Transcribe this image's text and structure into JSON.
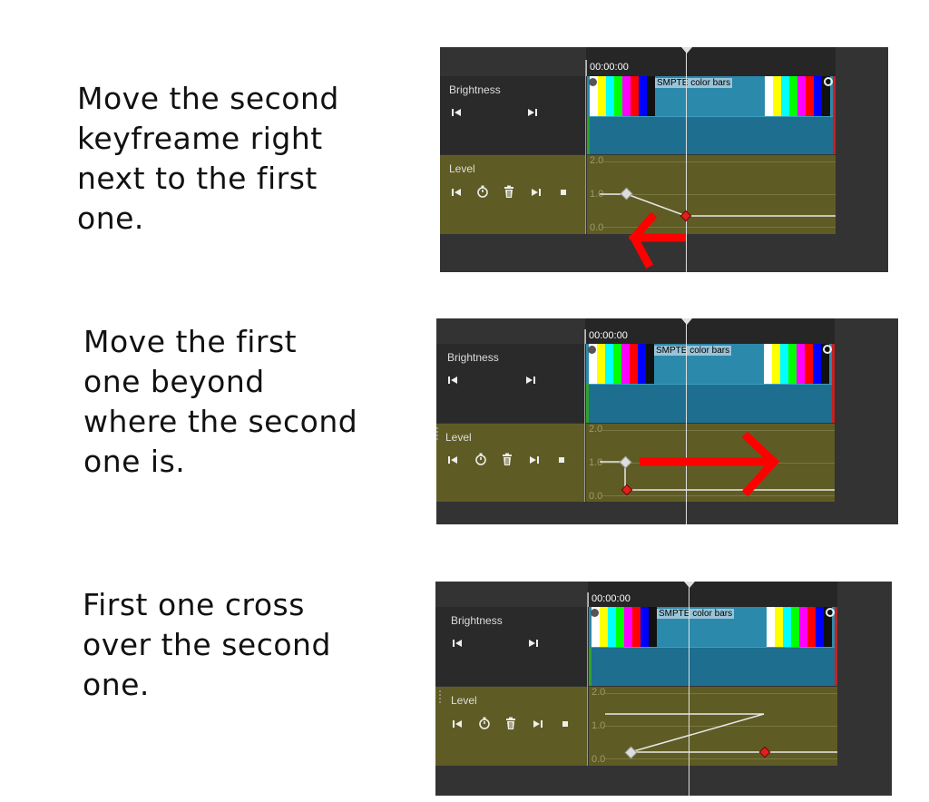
{
  "steps": [
    {
      "caption": [
        "Move the second",
        "keyfreame right",
        "next to the first",
        "one."
      ]
    },
    {
      "caption": [
        "Move the first",
        "one beyond",
        "where the second",
        "one is."
      ]
    },
    {
      "caption": [
        "First one cross",
        "over the second",
        "one."
      ]
    }
  ],
  "editor": {
    "timecode": "00:00:00",
    "video_track_label": "Brightness",
    "keyframe_track_label": "Level",
    "clip_title": "SMPTE color bars",
    "level_ticks": [
      "2.0",
      "1.0",
      "0.0"
    ],
    "icons": {
      "video_track": [
        "prev-keyframe-icon",
        "next-keyframe-icon"
      ],
      "level_track": [
        "prev-keyframe-icon",
        "stopwatch-icon",
        "trash-icon",
        "next-keyframe-icon",
        "stop-icon"
      ]
    },
    "colors": {
      "panel_bg": "#333333",
      "track_bg": "#5e5c24",
      "clip": "#2b89ab",
      "keyframe_selected": "#e02020",
      "keyframe": "#dddddd",
      "arrow": "#ff0000"
    },
    "smpte_bars": [
      "#ffffff",
      "#ffff00",
      "#00ffff",
      "#00ff00",
      "#ff00ff",
      "#ff0000",
      "#0000ff",
      "#111111"
    ]
  }
}
